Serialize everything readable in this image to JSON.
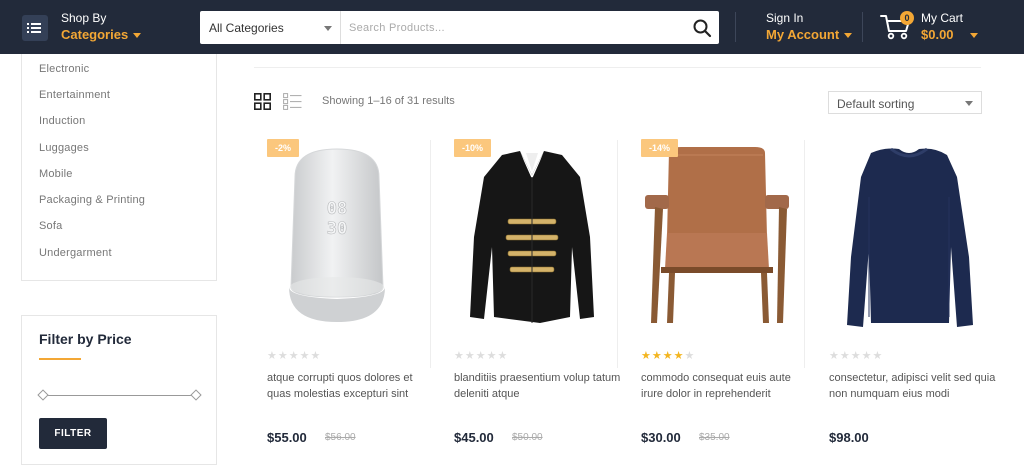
{
  "header": {
    "shop_by": "Shop By",
    "categories": "Categories",
    "search_category": "All Categories",
    "search_placeholder": "Search Products...",
    "sign_in": "Sign In",
    "my_account": "My Account",
    "cart_count": "0",
    "my_cart": "My Cart",
    "cart_total": "$0.00"
  },
  "sidebar": {
    "categories": [
      "Electronic",
      "Entertainment",
      "Induction",
      "Luggages",
      "Mobile",
      "Packaging & Printing",
      "Sofa",
      "Undergarment"
    ],
    "filter_title": "Filter by Price",
    "filter_button": "FILTER"
  },
  "toolbar": {
    "results": "Showing 1–16 of 31 results",
    "sort": "Default sorting"
  },
  "products": [
    {
      "badge": "-2%",
      "rating": 0,
      "name": "atque corrupti quos dolores et quas molestias excepturi sint",
      "price": "$55.00",
      "old_price": "$56.00",
      "image": "smart-speaker"
    },
    {
      "badge": "-10%",
      "rating": 0,
      "name": "blanditiis praesentium volup tatum deleniti atque",
      "price": "$45.00",
      "old_price": "$50.00",
      "image": "black-jacket"
    },
    {
      "badge": "-14%",
      "rating": 4,
      "name": "commodo consequat euis aute irure dolor in reprehenderit",
      "price": "$30.00",
      "old_price": "$35.00",
      "image": "leather-armchair"
    },
    {
      "badge": "",
      "rating": 0,
      "name": "consectetur, adipisci velit sed quia non numquam eius modi",
      "price": "$98.00",
      "old_price": "",
      "image": "navy-long-sleeve-shirt"
    }
  ],
  "colors": {
    "header_bg": "#222a3a",
    "accent": "#f3a735",
    "badge": "#fbc77d",
    "star": "#f3b520"
  }
}
